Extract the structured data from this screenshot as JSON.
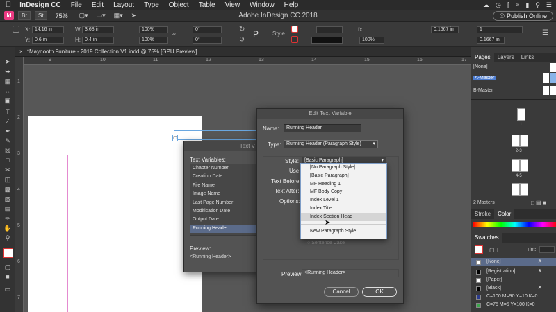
{
  "menubar": {
    "apple": "",
    "app": "InDesign CC",
    "items": [
      "File",
      "Edit",
      "Layout",
      "Type",
      "Object",
      "Table",
      "View",
      "Window",
      "Help"
    ]
  },
  "appbar": {
    "logo": "Id",
    "bridge": "Br",
    "stock": "St",
    "zoom": "75%",
    "title": "Adobe InDesign CC 2018",
    "publish": "Publish Online"
  },
  "control": {
    "x": "14.16 in",
    "y": "0.6 in",
    "w": "3.68 in",
    "h": "0.4 in",
    "scale_x": "100%",
    "scale_y": "100%",
    "angle": "0°",
    "shear": "0°",
    "style_label": "Style",
    "stroke_pct": "100%",
    "gap": "0.1667 in",
    "gap2": "0.1667 in",
    "cols": "1"
  },
  "doc_tab": "*Maynooth Funiture - 2019 Collection V1.indd @ 75% [GPU Preview]",
  "ruler": {
    "h": [
      "9",
      "10",
      "11",
      "12",
      "13",
      "14",
      "15",
      "16",
      "17"
    ],
    "v": [
      "1",
      "2",
      "3",
      "4",
      "5",
      "6",
      "7"
    ]
  },
  "pages_panel": {
    "tabs": [
      "Pages",
      "Layers",
      "Links"
    ],
    "none": "[None]",
    "a_master": "A-Master",
    "b_master": "B-Master",
    "page_labels": [
      "1",
      "2-3",
      "4-5"
    ],
    "status": "2 Masters"
  },
  "stroke_panel": {
    "tabs": [
      "Stroke",
      "Color"
    ]
  },
  "swatches_panel": {
    "title": "Swatches",
    "tint_label": "Tint:",
    "items": [
      {
        "name": "[None]",
        "color": "#ffffff"
      },
      {
        "name": "[Registration]",
        "color": "#000000"
      },
      {
        "name": "[Paper]",
        "color": "#ffffff"
      },
      {
        "name": "[Black]",
        "color": "#000000"
      },
      {
        "name": "C=100 M=90 Y=10 K=0",
        "color": "#2a3a8c"
      },
      {
        "name": "C=75 M=5 Y=100 K=0",
        "color": "#3aa54a"
      }
    ]
  },
  "text_variables_dialog": {
    "title": "Text V",
    "heading": "Text Variables:",
    "items": [
      "Chapter Number",
      "Creation Date",
      "File Name",
      "Image Name",
      "Last Page Number",
      "Modification Date",
      "Output Date",
      "Running Header"
    ],
    "selected": "Running Header",
    "preview_label": "Preview:",
    "preview_value": "<Running Header>"
  },
  "edit_dialog": {
    "title": "Edit Text Variable",
    "name_label": "Name:",
    "name_value": "Running Header",
    "type_label": "Type:",
    "type_value": "Running Header (Paragraph Style)",
    "style_label": "Style:",
    "style_value": "[Basic Paragraph]",
    "use_label": "Use:",
    "text_before_label": "Text Before:",
    "text_after_label": "Text After:",
    "options_label": "Options:",
    "sentence_case": "Sentence Case",
    "preview_label": "Preview:",
    "preview_value": "<Running Header>",
    "cancel": "Cancel",
    "ok": "OK"
  },
  "style_dropdown": {
    "options": [
      "[No Paragraph Style]",
      "[Basic Paragraph]",
      "MF Heading 1",
      "MF Body Copy",
      "Index Level 1",
      "Index Title",
      "Index Section Head"
    ],
    "highlighted": "Index Section Head",
    "new_style": "New Paragraph Style..."
  }
}
